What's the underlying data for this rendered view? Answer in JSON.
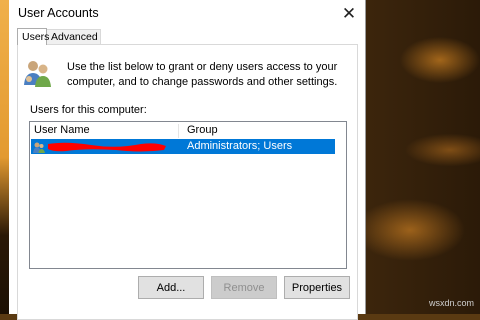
{
  "window": {
    "title": "User Accounts",
    "close_label": "✕"
  },
  "tabs": [
    {
      "label": "Users"
    },
    {
      "label": "Advanced"
    }
  ],
  "intro_text": "Use the list below to grant or deny users access to your computer, and to change passwords and other settings.",
  "users_list": {
    "label": "Users for this computer:",
    "columns": [
      "User Name",
      "Group"
    ],
    "rows": [
      {
        "user_name": "",
        "group": "Administrators; Users",
        "selected": true
      }
    ]
  },
  "buttons": {
    "add": "Add...",
    "remove": "Remove",
    "properties": "Properties"
  },
  "colors": {
    "selection": "#0078d7",
    "redaction": "#ff0000"
  },
  "watermark": "wsxdn.com"
}
